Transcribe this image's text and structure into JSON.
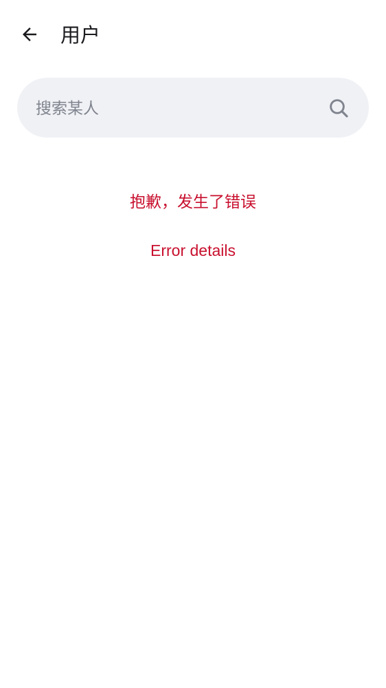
{
  "header": {
    "title": "用户",
    "back_icon": "arrow-back-icon"
  },
  "search": {
    "placeholder": "搜索某人",
    "value": "",
    "icon": "search-icon"
  },
  "error": {
    "message": "抱歉，发生了错误",
    "details_label": "Error details",
    "color": "#c8102e"
  },
  "colors": {
    "search_background": "#f0f1f5",
    "text_primary": "#1b1b1f",
    "placeholder": "#80848e"
  }
}
